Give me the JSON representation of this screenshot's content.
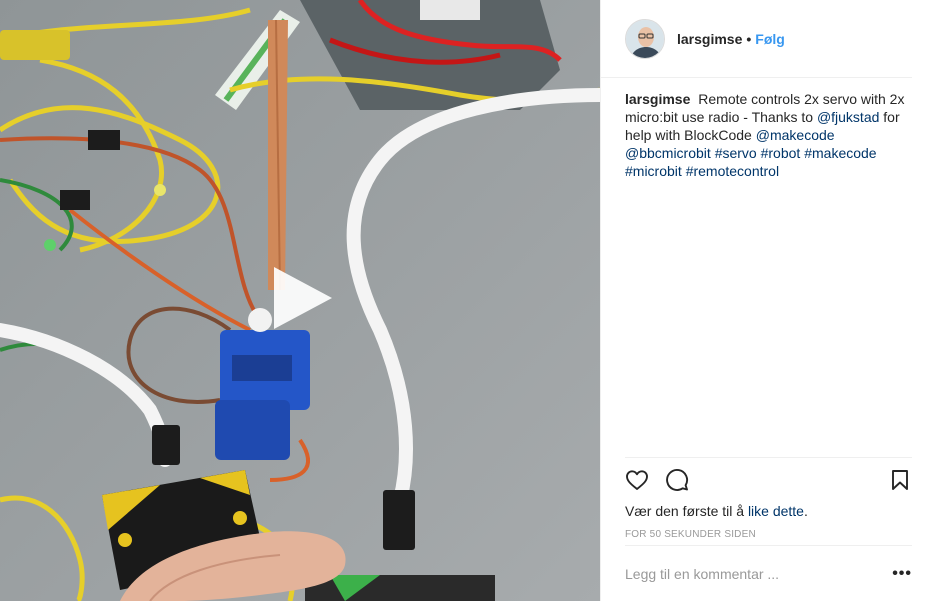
{
  "media": {
    "play_icon": "play-icon"
  },
  "header": {
    "username": "larsgimse",
    "separator": "•",
    "follow_label": "Følg"
  },
  "caption": {
    "username": "larsgimse",
    "text_1": "Remote controls 2x servo with 2x micro:bit use radio - Thanks to",
    "mention_1": "@fjukstad",
    "text_2": "for help with BlockCode",
    "mention_2": "@makecode",
    "hashtags": [
      "@bbcmicrobit",
      "#servo",
      "#robot",
      "#makecode",
      "#microbit",
      "#remotecontrol"
    ]
  },
  "actions": {
    "like_icon": "heart-icon",
    "comment_icon": "comment-icon",
    "save_icon": "bookmark-icon",
    "likes_prefix": "Vær den første til å",
    "likes_link": "like dette",
    "likes_suffix": ".",
    "timestamp": "FOR 50 SEKUNDER SIDEN"
  },
  "comment": {
    "placeholder": "Legg til en kommentar ...",
    "more_label": "•••"
  },
  "colors": {
    "link": "#003569",
    "follow": "#3897f0",
    "text": "#262626",
    "muted": "#999999"
  }
}
